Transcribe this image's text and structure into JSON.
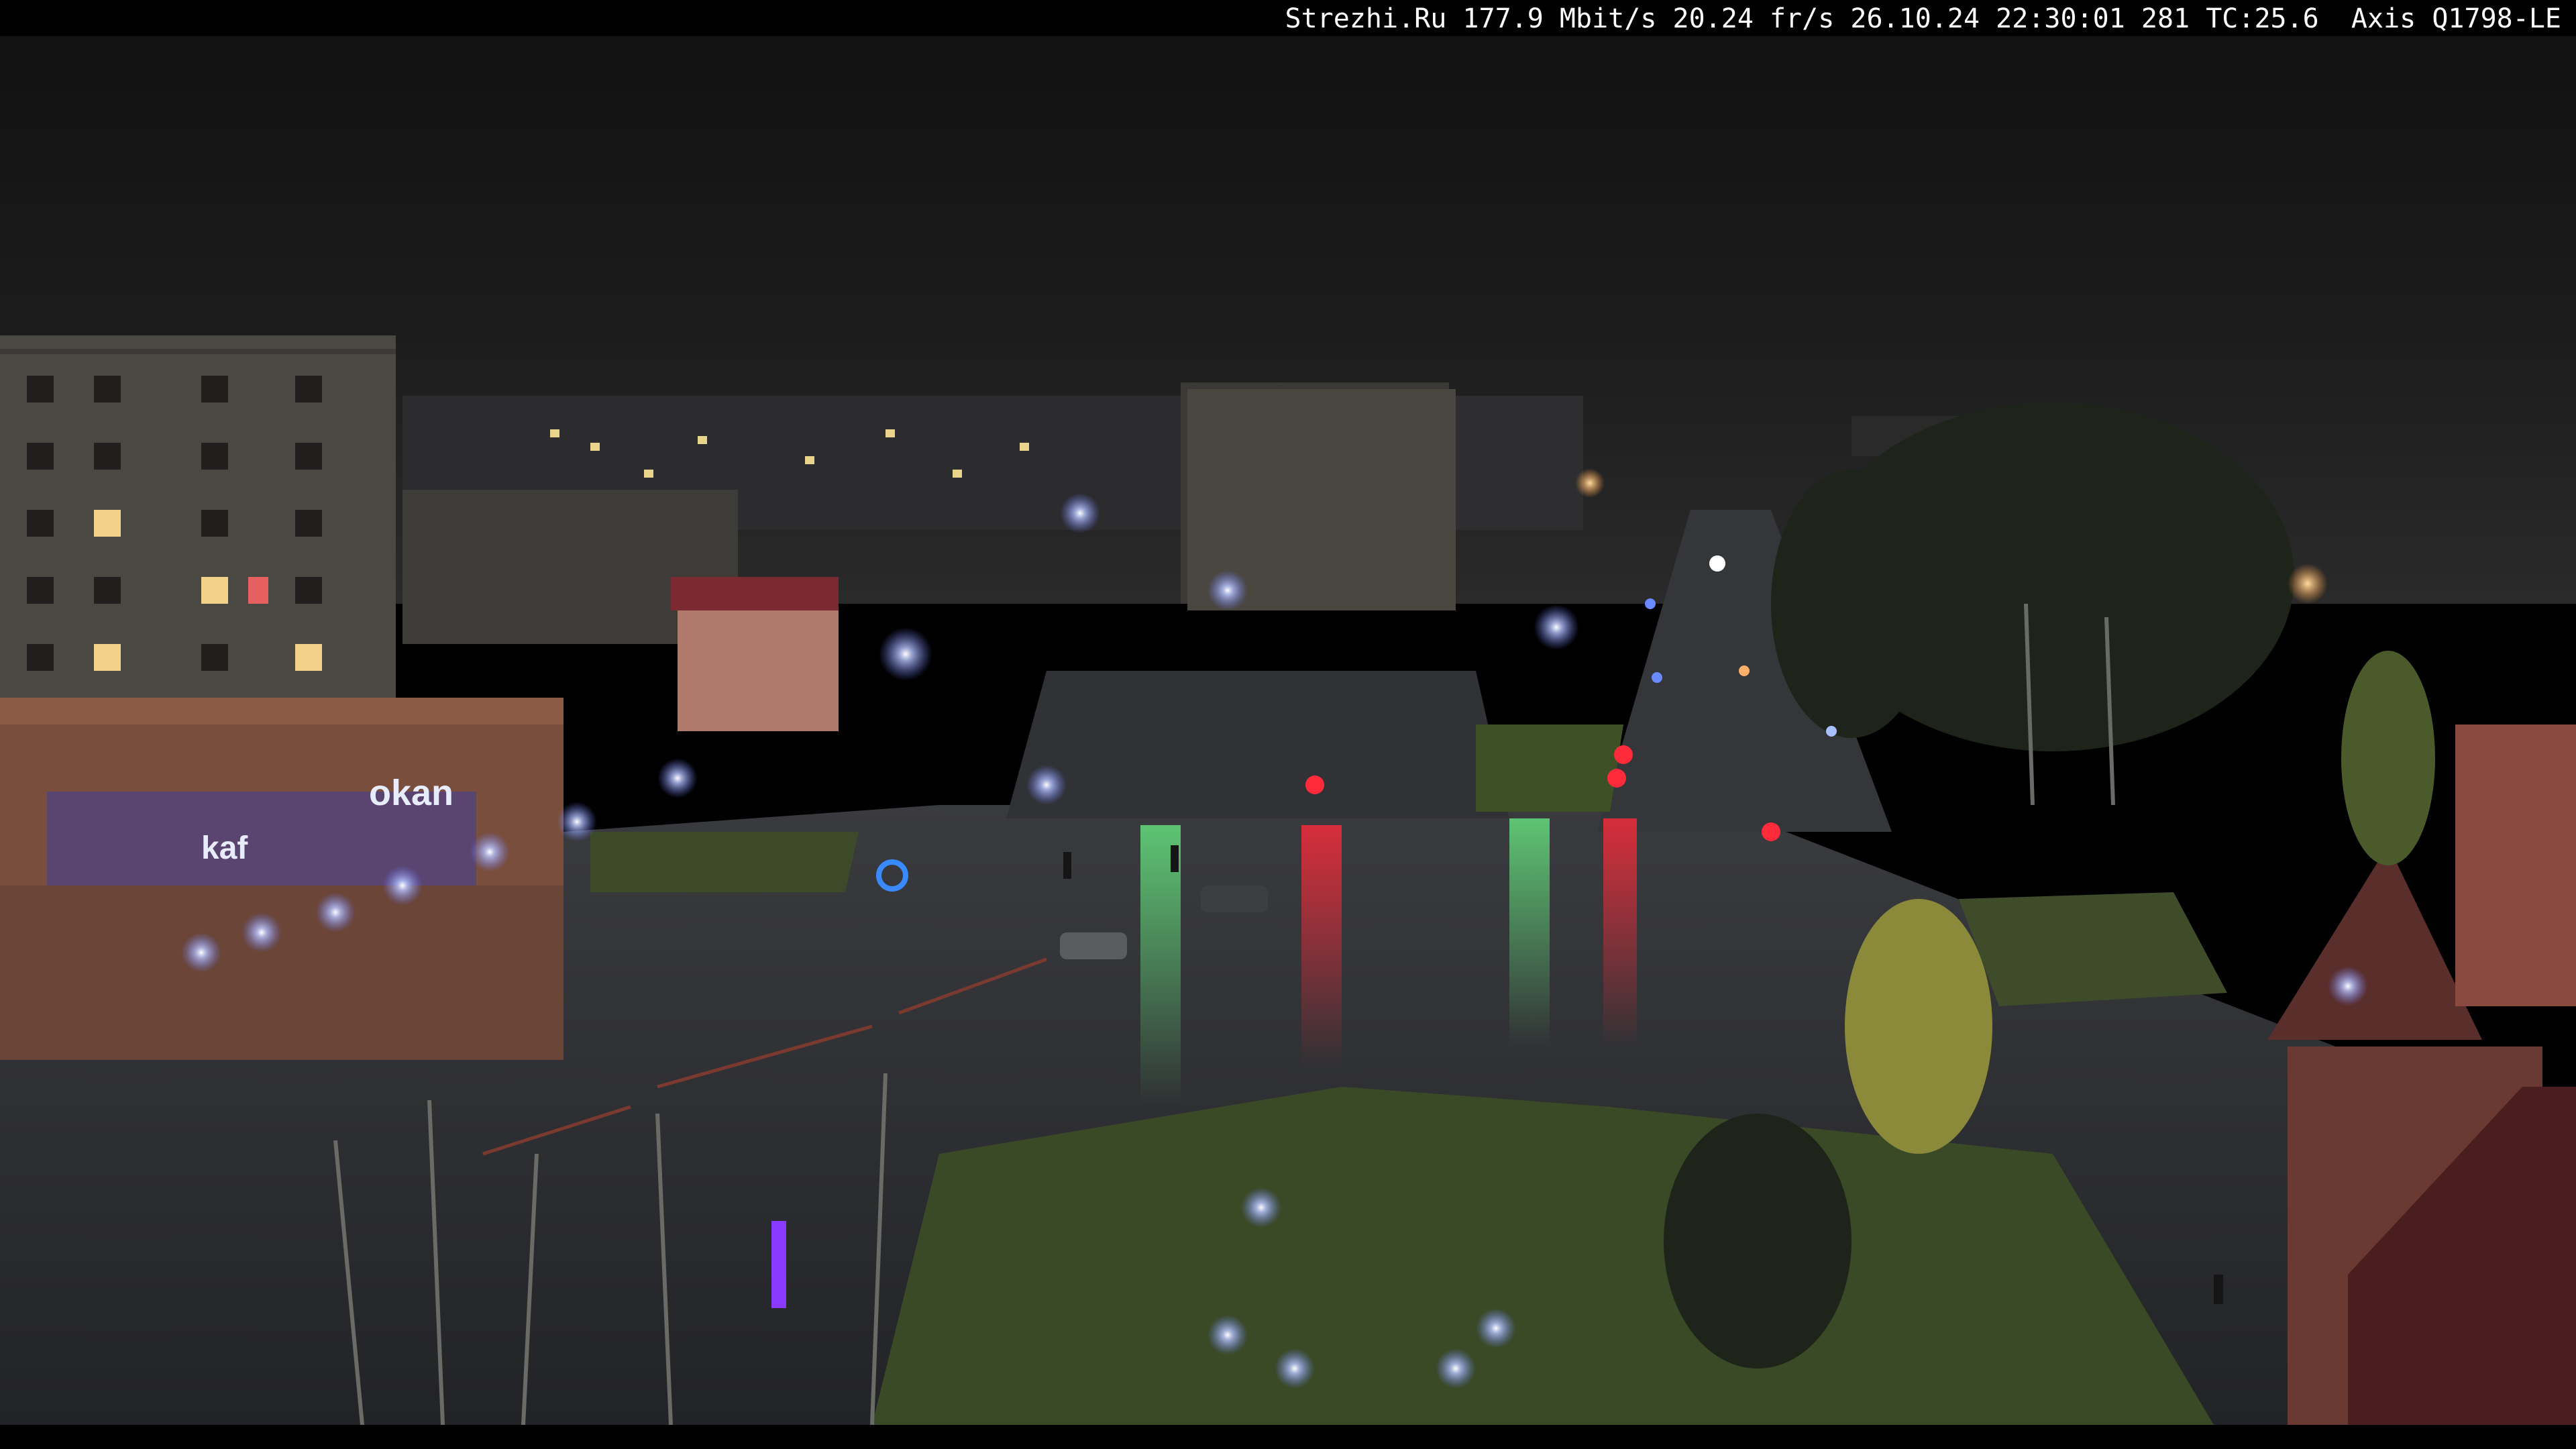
{
  "overlay": {
    "text": "Strezhi.Ru 177.9 Mbit/s 20.24 fr/s 26.10.24 22:30:01 281 TC:25.6  Axis Q1798-LE"
  },
  "signs": {
    "store_logo": "okan",
    "store_sign": "kaf"
  },
  "colors": {
    "sky": "#141414",
    "road": "#2b2d2f",
    "grass": "#3d4a2a",
    "lamp_light": "#c9d4ff",
    "red_light": "#ff2a3a",
    "green_light": "#4dff7a"
  }
}
